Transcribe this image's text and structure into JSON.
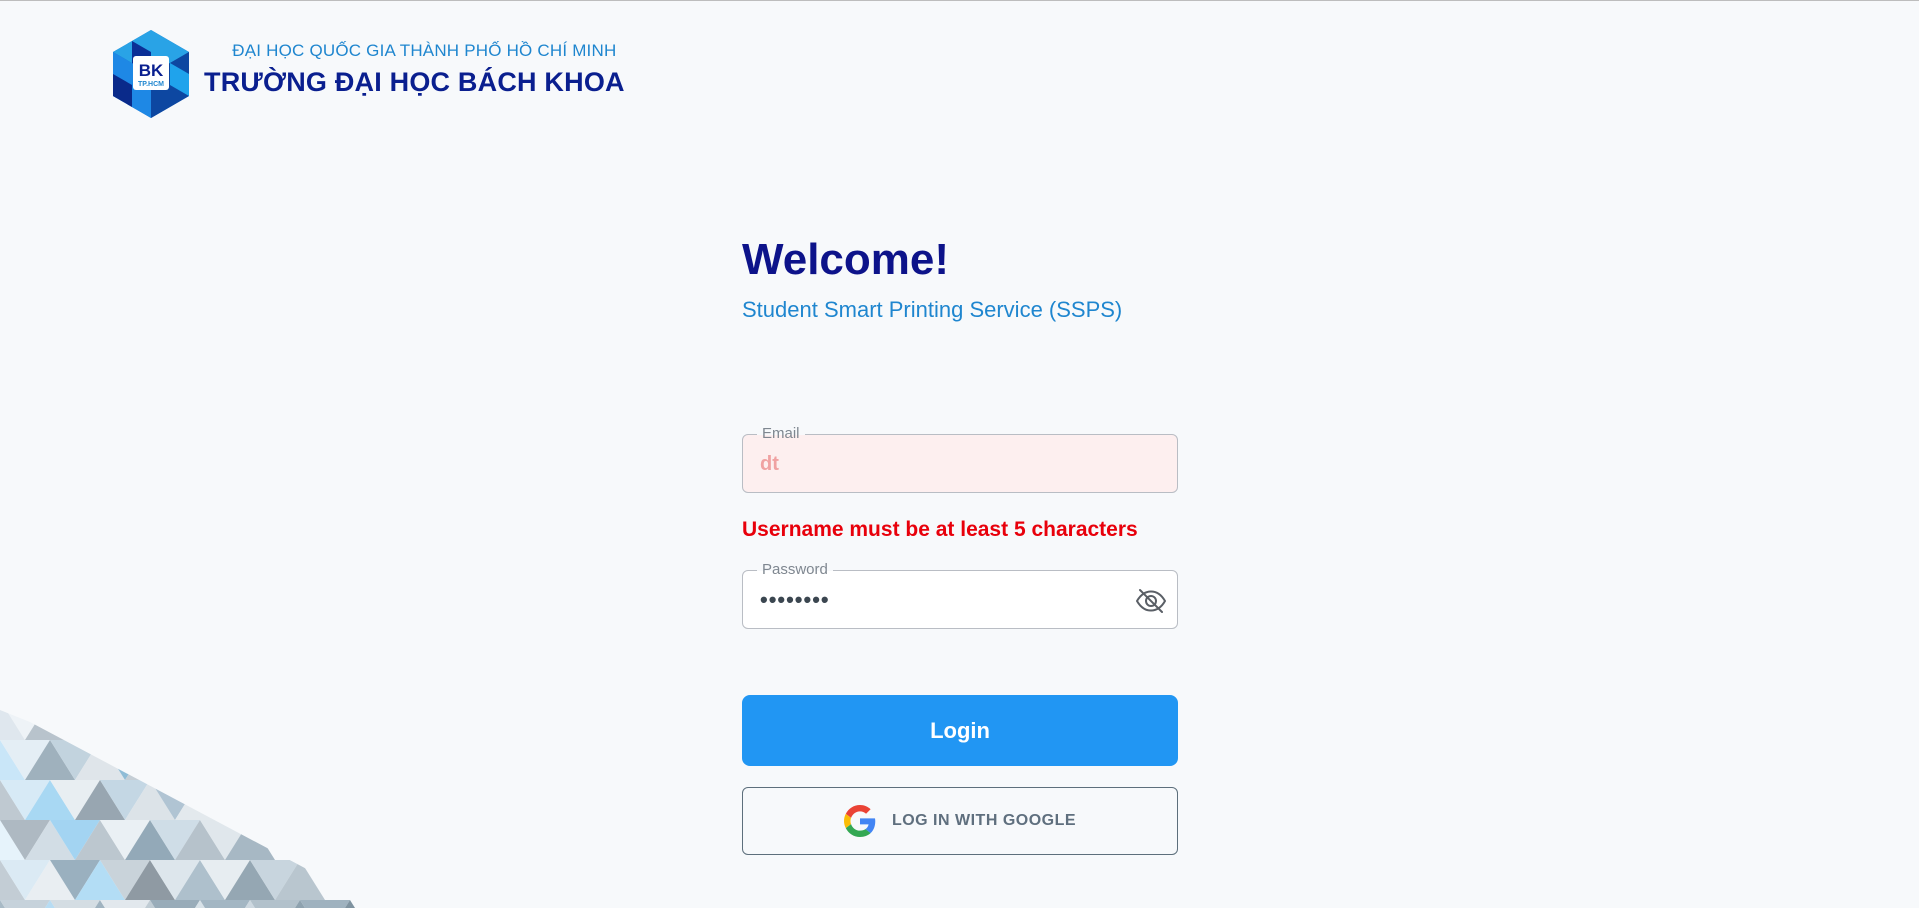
{
  "header": {
    "org_parent": "ĐẠI HỌC QUỐC GIA THÀNH PHỐ HỒ CHÍ MINH",
    "org_name": "TRƯỜNG ĐẠI HỌC BÁCH KHOA",
    "logo_text": "BK",
    "logo_subtext": "TP.HCM"
  },
  "login": {
    "title": "Welcome!",
    "subtitle": "Student Smart Printing Service (SSPS)",
    "email": {
      "label": "Email",
      "value": "dt"
    },
    "error_message": "Username must be at least 5 characters",
    "password": {
      "label": "Password",
      "value": "••••••••",
      "toggle_icon": "eye-off-icon"
    },
    "login_button": "Login",
    "google_button": "LOG IN WITH GOOGLE",
    "google_icon": "google-icon"
  },
  "colors": {
    "primary": "#2196f3",
    "title": "#0d138a",
    "subtitle": "#1f86cf",
    "error": "#e8000b",
    "email_field_bg": "#fdefef"
  }
}
